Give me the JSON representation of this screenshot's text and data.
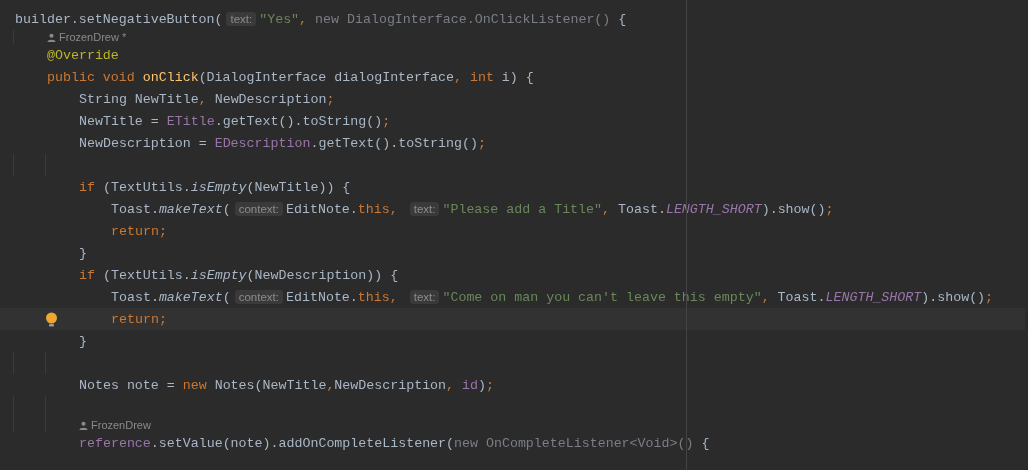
{
  "editor": {
    "lines": [
      {
        "kind": "code",
        "current": false,
        "tokens": [
          {
            "kind": "plain",
            "text": "builder.setNegativeButton("
          },
          {
            "kind": "hint",
            "text": "text:"
          },
          {
            "kind": "string",
            "text": "\"Yes\""
          },
          {
            "kind": "punct",
            "text": ", "
          },
          {
            "kind": "dim",
            "text": "new DialogInterface.OnClickListener()"
          },
          {
            "kind": "plain",
            "text": " {"
          }
        ],
        "children": [
          {
            "kind": "author",
            "text": "FrozenDrew *"
          },
          {
            "kind": "code",
            "current": false,
            "tokens": [
              {
                "kind": "annotation",
                "text": "@Override"
              }
            ]
          },
          {
            "kind": "code",
            "current": false,
            "tokens": [
              {
                "kind": "keyword",
                "text": "public void "
              },
              {
                "kind": "method",
                "text": "onClick"
              },
              {
                "kind": "plain",
                "text": "(DialogInterface dialogInterface"
              },
              {
                "kind": "punct",
                "text": ", "
              },
              {
                "kind": "keyword",
                "text": "int"
              },
              {
                "kind": "plain",
                "text": " i) {"
              }
            ],
            "children": [
              {
                "kind": "code",
                "current": false,
                "tokens": [
                  {
                    "kind": "plain",
                    "text": "String NewTitle"
                  },
                  {
                    "kind": "punct",
                    "text": ", "
                  },
                  {
                    "kind": "plain",
                    "text": "NewDescription"
                  },
                  {
                    "kind": "punct",
                    "text": ";"
                  }
                ]
              },
              {
                "kind": "code",
                "current": false,
                "tokens": [
                  {
                    "kind": "plain",
                    "text": "NewTitle = "
                  },
                  {
                    "kind": "field",
                    "text": "ETitle"
                  },
                  {
                    "kind": "plain",
                    "text": ".getText().toString()"
                  },
                  {
                    "kind": "punct",
                    "text": ";"
                  }
                ]
              },
              {
                "kind": "code",
                "current": false,
                "tokens": [
                  {
                    "kind": "plain",
                    "text": "NewDescription = "
                  },
                  {
                    "kind": "field",
                    "text": "EDescription"
                  },
                  {
                    "kind": "plain",
                    "text": ".getText().toString()"
                  },
                  {
                    "kind": "punct",
                    "text": ";"
                  }
                ]
              },
              {
                "kind": "blank"
              },
              {
                "kind": "code",
                "current": false,
                "tokens": [
                  {
                    "kind": "keyword",
                    "text": "if "
                  },
                  {
                    "kind": "plain",
                    "text": "(TextUtils."
                  },
                  {
                    "kind": "static_method",
                    "text": "isEmpty"
                  },
                  {
                    "kind": "plain",
                    "text": "(NewTitle)) {"
                  }
                ],
                "children": [
                  {
                    "kind": "code",
                    "current": false,
                    "tokens": [
                      {
                        "kind": "plain",
                        "text": "Toast."
                      },
                      {
                        "kind": "static_method",
                        "text": "makeText"
                      },
                      {
                        "kind": "plain",
                        "text": "("
                      },
                      {
                        "kind": "hint",
                        "text": "context:"
                      },
                      {
                        "kind": "plain",
                        "text": "EditNote."
                      },
                      {
                        "kind": "keyword",
                        "text": "this"
                      },
                      {
                        "kind": "punct",
                        "text": ", "
                      },
                      {
                        "kind": "hint",
                        "text": "text:"
                      },
                      {
                        "kind": "string",
                        "text": "\"Please add a Title\""
                      },
                      {
                        "kind": "punct",
                        "text": ", "
                      },
                      {
                        "kind": "plain",
                        "text": "Toast."
                      },
                      {
                        "kind": "static_field",
                        "text": "LENGTH_SHORT"
                      },
                      {
                        "kind": "plain",
                        "text": ").show()"
                      },
                      {
                        "kind": "punct",
                        "text": ";"
                      }
                    ]
                  },
                  {
                    "kind": "code",
                    "current": false,
                    "tokens": [
                      {
                        "kind": "keyword",
                        "text": "return;"
                      }
                    ]
                  }
                ]
              },
              {
                "kind": "code",
                "current": false,
                "tokens": [
                  {
                    "kind": "plain",
                    "text": "}"
                  }
                ]
              },
              {
                "kind": "code",
                "current": false,
                "tokens": [
                  {
                    "kind": "keyword",
                    "text": "if "
                  },
                  {
                    "kind": "plain",
                    "text": "(TextUtils."
                  },
                  {
                    "kind": "static_method",
                    "text": "isEmpty"
                  },
                  {
                    "kind": "plain",
                    "text": "(NewDescription)) {"
                  }
                ],
                "children": [
                  {
                    "kind": "code",
                    "current": false,
                    "tokens": [
                      {
                        "kind": "plain",
                        "text": "Toast."
                      },
                      {
                        "kind": "static_method",
                        "text": "makeText"
                      },
                      {
                        "kind": "plain",
                        "text": "("
                      },
                      {
                        "kind": "hint",
                        "text": "context:"
                      },
                      {
                        "kind": "plain",
                        "text": "EditNote."
                      },
                      {
                        "kind": "keyword",
                        "text": "this"
                      },
                      {
                        "kind": "punct",
                        "text": ", "
                      },
                      {
                        "kind": "hint",
                        "text": "text:"
                      },
                      {
                        "kind": "string",
                        "text": "\"Come on man you can't leave this empty\""
                      },
                      {
                        "kind": "punct",
                        "text": ", "
                      },
                      {
                        "kind": "plain",
                        "text": "Toast."
                      },
                      {
                        "kind": "static_field",
                        "text": "LENGTH_SHORT"
                      },
                      {
                        "kind": "plain",
                        "text": ").show()"
                      },
                      {
                        "kind": "punct",
                        "text": ";"
                      }
                    ]
                  },
                  {
                    "kind": "code",
                    "current": true,
                    "tokens": [
                      {
                        "kind": "keyword",
                        "text": "return;"
                      }
                    ]
                  }
                ]
              },
              {
                "kind": "code",
                "current": false,
                "tokens": [
                  {
                    "kind": "plain",
                    "text": "}"
                  }
                ]
              },
              {
                "kind": "blank"
              },
              {
                "kind": "code",
                "current": false,
                "tokens": [
                  {
                    "kind": "plain",
                    "text": "Notes note = "
                  },
                  {
                    "kind": "keyword",
                    "text": "new "
                  },
                  {
                    "kind": "plain",
                    "text": "Notes(NewTitle"
                  },
                  {
                    "kind": "punct",
                    "text": ","
                  },
                  {
                    "kind": "plain",
                    "text": "NewDescription"
                  },
                  {
                    "kind": "punct",
                    "text": ", "
                  },
                  {
                    "kind": "field",
                    "text": "id"
                  },
                  {
                    "kind": "plain",
                    "text": ")"
                  },
                  {
                    "kind": "punct",
                    "text": ";"
                  }
                ]
              },
              {
                "kind": "blank"
              },
              {
                "kind": "author",
                "text": "FrozenDrew"
              },
              {
                "kind": "code",
                "current": false,
                "tokens": [
                  {
                    "kind": "field",
                    "text": "reference"
                  },
                  {
                    "kind": "plain",
                    "text": ".setValue(note).addOnCompleteListener("
                  },
                  {
                    "kind": "dim",
                    "text": "new OnCompleteListener<Void>()"
                  },
                  {
                    "kind": "plain",
                    "text": " {"
                  }
                ]
              }
            ]
          }
        ]
      }
    ]
  }
}
